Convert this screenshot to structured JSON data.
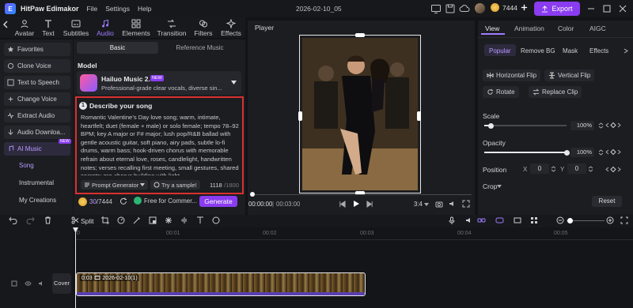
{
  "titlebar": {
    "app_name": "HitPaw Edimakor",
    "menu_file": "File",
    "menu_settings": "Settings",
    "menu_help": "Help",
    "project_name": "2026-02-10_05",
    "credits": "7444",
    "export_label": "Export"
  },
  "toolbar": {
    "tabs": [
      "Avatar",
      "Text",
      "Subtitles",
      "Audio",
      "Elements",
      "Transition",
      "Filters",
      "Effects"
    ],
    "active": "Audio"
  },
  "leftnav": {
    "items": [
      "Favorites",
      "Clone Voice",
      "Text to Speech",
      "Change Voice",
      "Extract Audio",
      "Audio Downloa...",
      "AI Music"
    ],
    "subs": [
      "Song",
      "Instrumental",
      "My Creations"
    ],
    "new_badge": "NEW"
  },
  "music": {
    "tab_basic": "Basic",
    "tab_reference": "Reference Music",
    "model_label": "Model",
    "model_name": "Hailuo Music 2.0",
    "model_badge": "NEW",
    "model_desc": "Professional-grade clear vocals, diverse sin...",
    "step_num": "1",
    "desc_title": "Describe your song",
    "desc_text": "Romantic Valentine’s Day love song; warm, intimate, heartfelt; duet (female + male) or solo female; tempo 78–92 BPM; key A major or F# major; lush pop/R&B ballad with gentle acoustic guitar, soft piano, airy pads, subtle lo-fi drums, warm bass; hook-driven chorus with memorable refrain about eternal love, roses, candlelight, handwritten notes; verses recalling first meeting, small gestures, shared secrets; pre-chorus building with light",
    "prompt_generator": "Prompt Generator",
    "try_sample": "Try a sample!",
    "char_count": "1118",
    "char_max": "/1800",
    "cost_used": "30",
    "cost_total": "/7444",
    "free_label": "Free for Commer...",
    "generate_label": "Generate"
  },
  "player": {
    "title": "Player",
    "time_current": "00:00:00",
    "time_sep": "|",
    "time_total": "00:03:00",
    "aspect": "3:4"
  },
  "right": {
    "tabs": [
      "View",
      "Animation",
      "Color",
      "AIGC"
    ],
    "subtabs": [
      "Popular",
      "Remove BG",
      "Mask",
      "Effects"
    ],
    "horizontal_flip": "Horizontal Flip",
    "vertical_flip": "Vertical Flip",
    "rotate": "Rotate",
    "replace_clip": "Replace Clip",
    "scale_label": "Scale",
    "scale_value": "100%",
    "scale_level": 0.08,
    "opacity_label": "Opacity",
    "opacity_value": "100%",
    "opacity_level": 1.0,
    "position_label": "Position",
    "pos_x_label": "X",
    "pos_x": "0",
    "pos_y_label": "Y",
    "pos_y": "0",
    "crop_label": "Crop",
    "reset_label": "Reset"
  },
  "timeline": {
    "split_label": "Split",
    "ticks": [
      "0",
      "00:01",
      "00:02",
      "00:03",
      "00:04",
      "00:05"
    ],
    "cover_label": "Cover",
    "clip_label": "0:03 🎞 2026-02-10(1)"
  }
}
